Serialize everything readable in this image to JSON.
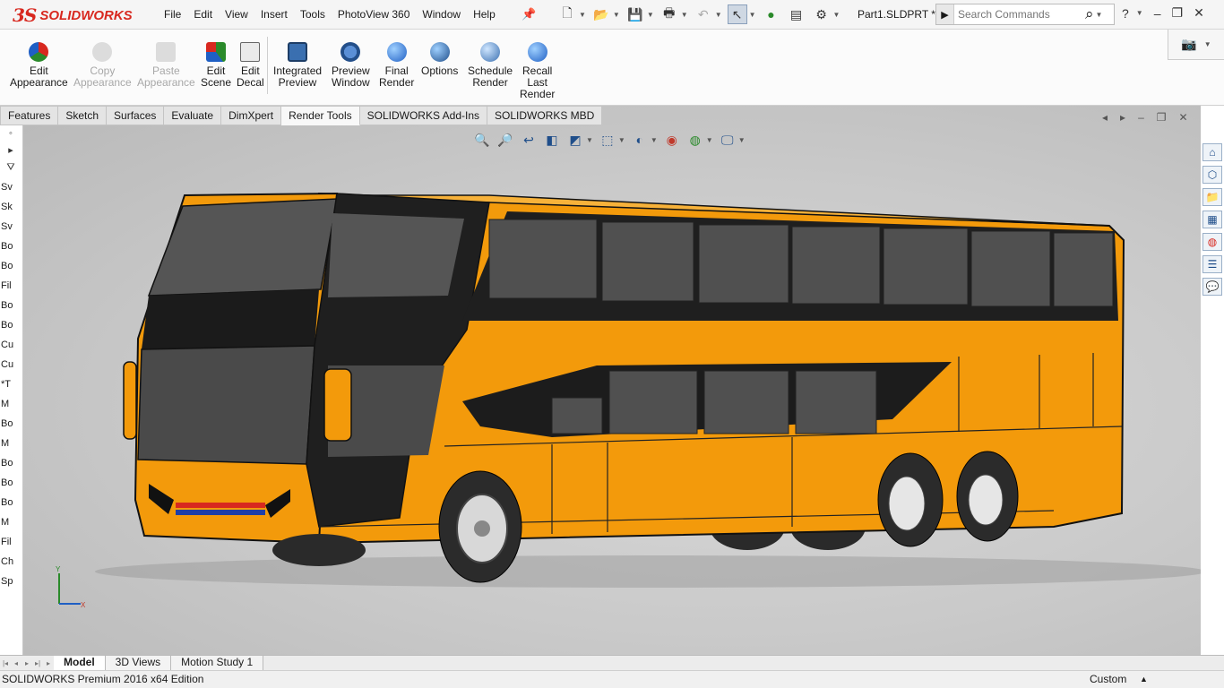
{
  "app": {
    "brand": "SOLIDWORKS",
    "document_title": "Part1.SLDPRT *"
  },
  "menu": [
    "File",
    "Edit",
    "View",
    "Insert",
    "Tools",
    "PhotoView 360",
    "Window",
    "Help"
  ],
  "search": {
    "placeholder": "Search Commands"
  },
  "ribbon": {
    "buttons": [
      {
        "label1": "Edit",
        "label2": "Appearance",
        "label3": "",
        "enabled": true
      },
      {
        "label1": "Copy",
        "label2": "Appearance",
        "label3": "",
        "enabled": false
      },
      {
        "label1": "Paste",
        "label2": "Appearance",
        "label3": "",
        "enabled": false
      },
      {
        "label1": "Edit",
        "label2": "Scene",
        "label3": "",
        "enabled": true
      },
      {
        "label1": "Edit",
        "label2": "Decal",
        "label3": "",
        "enabled": true
      },
      {
        "label1": "Integrated",
        "label2": "Preview",
        "label3": "",
        "enabled": true
      },
      {
        "label1": "Preview",
        "label2": "Window",
        "label3": "",
        "enabled": true
      },
      {
        "label1": "Final",
        "label2": "Render",
        "label3": "",
        "enabled": true
      },
      {
        "label1": "Options",
        "label2": "",
        "label3": "",
        "enabled": true
      },
      {
        "label1": "Schedule",
        "label2": "Render",
        "label3": "",
        "enabled": true
      },
      {
        "label1": "Recall",
        "label2": "Last",
        "label3": "Render",
        "enabled": true
      }
    ]
  },
  "command_tabs": [
    "Features",
    "Sketch",
    "Surfaces",
    "Evaluate",
    "DimXpert",
    "Render Tools",
    "SOLIDWORKS Add-Ins",
    "SOLIDWORKS MBD"
  ],
  "active_command_tab": "Render Tools",
  "feature_tree": [
    "Sv",
    "Sk",
    "Sv",
    "Bo",
    "Bo",
    "Fil",
    "Bo",
    "Bo",
    "Cu",
    "Cu",
    "*T",
    "M",
    "Bo",
    "M",
    "Bo",
    "Bo",
    "Bo",
    "M",
    "Fil",
    "Ch",
    "Sp"
  ],
  "bottom_tabs": [
    "Model",
    "3D Views",
    "Motion Study 1"
  ],
  "active_bottom_tab": "Model",
  "status": {
    "left": "SOLIDWORKS Premium 2016 x64 Edition",
    "units": "Custom"
  },
  "triad": {
    "y": "Y",
    "x": "X"
  },
  "colors": {
    "bus_body": "#f39a0b",
    "glass": "#4a4a4a",
    "accent_red": "#d8281f"
  }
}
